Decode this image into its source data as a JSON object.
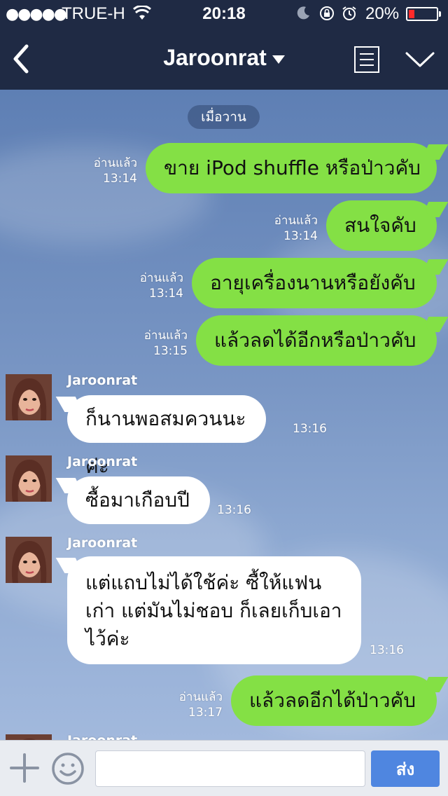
{
  "status_bar": {
    "signal": "●●●●●",
    "carrier": "TRUE-H",
    "time": "20:18",
    "battery_percent": "20%",
    "battery_level": 0.2,
    "battery_color": "#ff2a2a"
  },
  "nav": {
    "title": "Jaroonrat",
    "icons": [
      "back-chevron-icon",
      "notes-icon",
      "collapse-chevron-icon"
    ]
  },
  "chat": {
    "date_label": "เมื่อวาน",
    "read_label": "อ่านแล้ว",
    "outgoing": [
      {
        "text": "ขาย iPod shuffle หรือป่าวคับ",
        "time": "13:14"
      },
      {
        "text": "สนใจคับ",
        "time": "13:14"
      },
      {
        "text": "อายุเครื่องนานหรือยังคับ",
        "time": "13:14"
      },
      {
        "text": "แล้วลดได้อีกหรือป่าวคับ",
        "time": "13:15"
      },
      {
        "text": "แล้วลดอีกได้ป่าวคับ",
        "time": "13:17"
      }
    ],
    "incoming": [
      {
        "sender": "Jaroonrat",
        "text": "ก็นานพอสมควนนะค่ะ",
        "time": "13:16"
      },
      {
        "sender": "Jaroonrat",
        "text": "ซื้อมาเกือบปี",
        "time": "13:16"
      },
      {
        "sender": "Jaroonrat",
        "lines": [
          "แต่แถบไม่ได้ใช้ค่ะ ซื้ให้แฟน",
          "เก่า แต่มันไม่ชอบ ก็เลยเก็บเอา",
          "ไว้ค่ะ"
        ],
        "time": "13:16"
      },
      {
        "sender": "Jaroonrat"
      }
    ]
  },
  "composer": {
    "send_label": "ส่ง",
    "placeholder": ""
  }
}
